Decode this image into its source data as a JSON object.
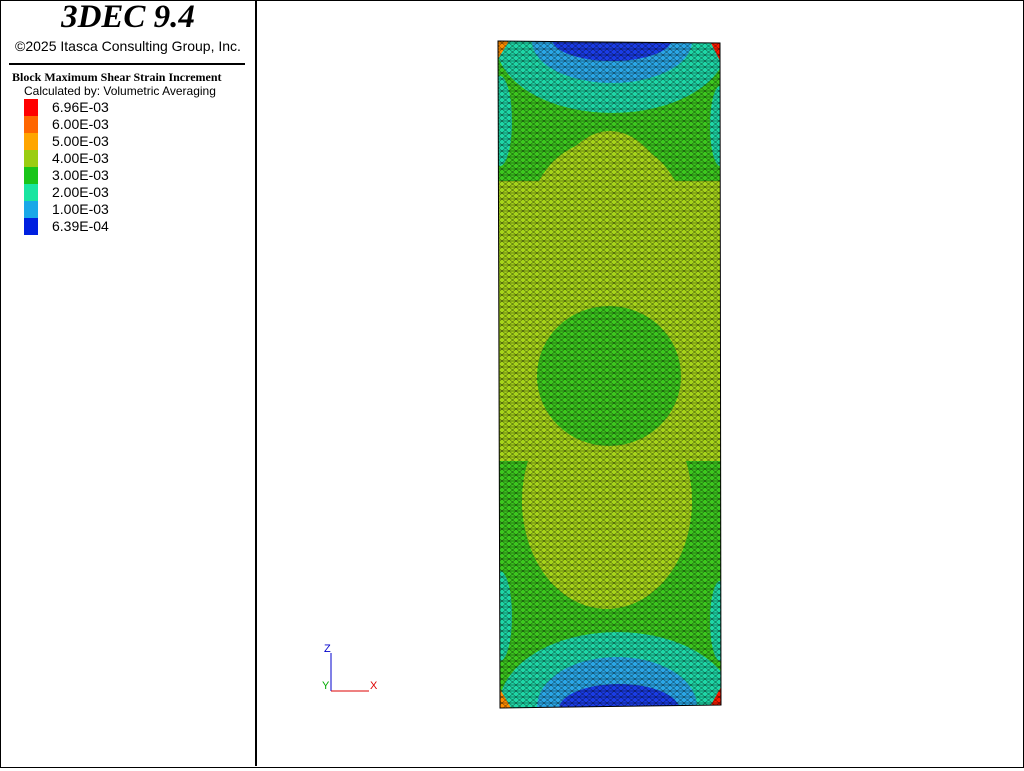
{
  "app": {
    "title": "3DEC 9.4",
    "copyright": "©2025 Itasca Consulting Group, Inc."
  },
  "plot": {
    "title": "Block  Maximum Shear Strain Increment",
    "subtitle": "Calculated by: Volumetric Averaging"
  },
  "legend": {
    "labels": [
      "6.96E-03",
      "6.00E-03",
      "5.00E-03",
      "4.00E-03",
      "3.00E-03",
      "2.00E-03",
      "1.00E-03",
      "6.39E-04"
    ],
    "colors": [
      "#ff0000",
      "#ff6600",
      "#ffa500",
      "#9acd11",
      "#19c519",
      "#19e5a0",
      "#1aa8e8",
      "#0020e0"
    ]
  },
  "axes": {
    "z": "Z",
    "y": "Y",
    "x": "X",
    "colors": {
      "z": "#0000cc",
      "y": "#00aa00",
      "x": "#dd0000"
    }
  },
  "contour_colors": {
    "yellow_green": "#a6d41a",
    "green": "#3cc71e",
    "cyan": "#1ed6a6",
    "light_blue": "#2aa6e6",
    "blue": "#1a3ce6",
    "orange": "#ff8c00",
    "red": "#ff1a00"
  }
}
